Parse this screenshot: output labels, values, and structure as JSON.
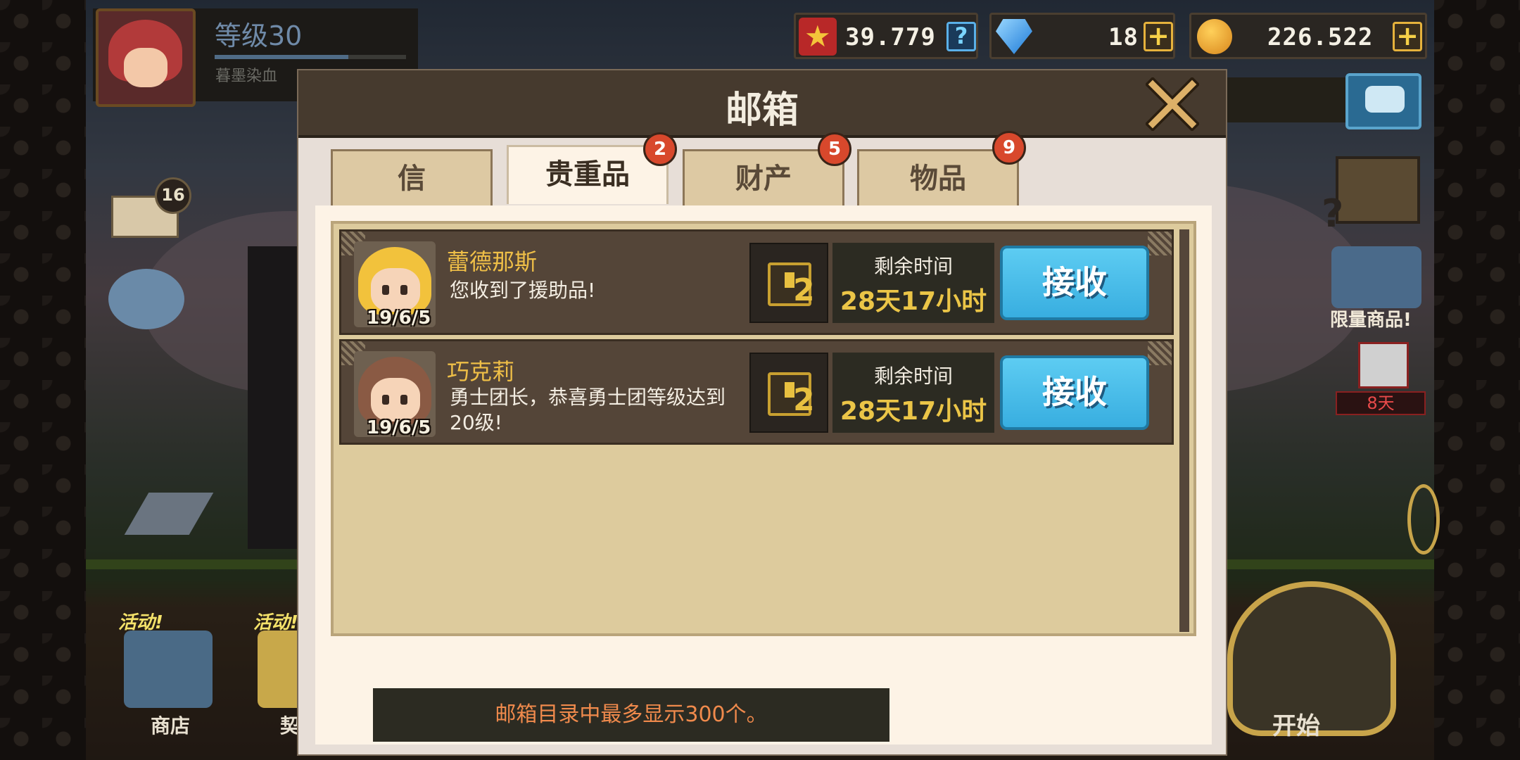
{
  "player": {
    "level": "等级30",
    "name": "暮墨染血",
    "level_progress": 0.7
  },
  "resources": {
    "medals": "39.779",
    "gems": "18",
    "gold": "226.522",
    "help_icon": "question-icon",
    "add_icon": "plus-icon"
  },
  "side": {
    "mail_count": "16",
    "limited_shop": "限量商品!",
    "gift_days": "8天",
    "shop": "商店",
    "contract": "契约",
    "start": "开始",
    "event_tag": "活动!"
  },
  "mailbox": {
    "title": "邮箱",
    "tabs": [
      {
        "label": "信",
        "badge": ""
      },
      {
        "label": "贵重品",
        "badge": "2",
        "active": true
      },
      {
        "label": "财产",
        "badge": "5"
      },
      {
        "label": "物品",
        "badge": "9"
      }
    ],
    "mails": [
      {
        "sender": "蕾德那斯",
        "date": "19/6/5",
        "message": "您收到了援助品!",
        "time_label": "剩余时间",
        "time_left": "28天17小时",
        "button": "接收",
        "item_icon": "ticket-box-icon"
      },
      {
        "sender": "巧克莉",
        "date": "19/6/5",
        "message": "勇士团长，恭喜勇士团等级达到20级!",
        "time_label": "剩余时间",
        "time_left": "28天17小时",
        "button": "接收",
        "item_icon": "ticket-box-icon"
      }
    ],
    "notice": "邮箱目录中最多显示300个。"
  },
  "colors": {
    "accent_gold": "#ebc547",
    "button_blue": "#38aee0",
    "badge_red": "#d8482c",
    "panel": "#fdf3e6"
  }
}
